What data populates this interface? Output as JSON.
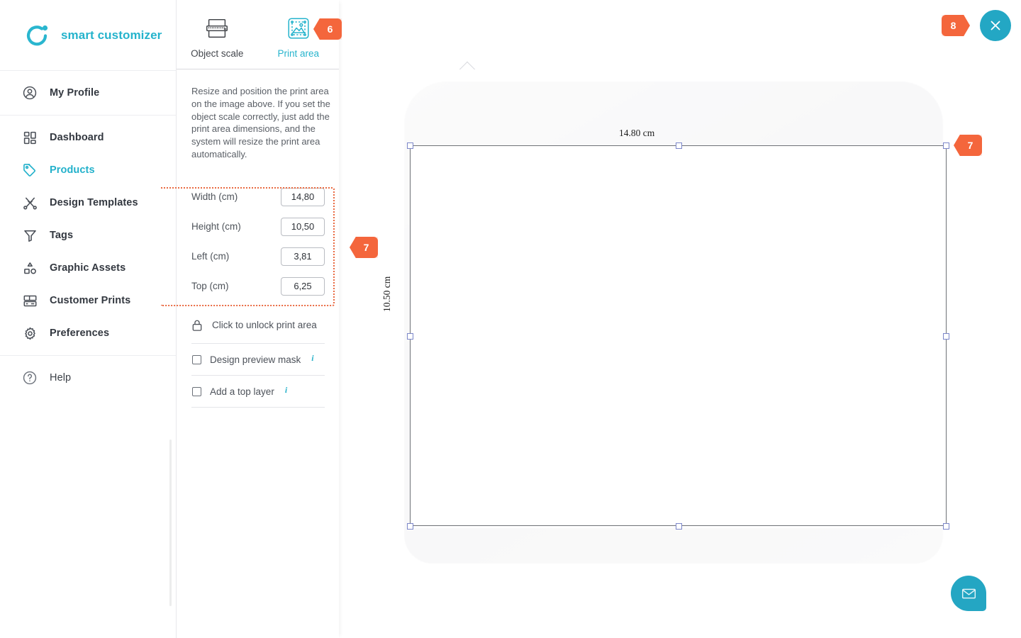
{
  "brand": {
    "name": "smart customizer",
    "logo_icon": "circle-dot-logo",
    "color": "#25b3cc"
  },
  "sidebar": {
    "profile": {
      "label": "My Profile",
      "icon": "user-circle-icon"
    },
    "items": [
      {
        "label": "Dashboard",
        "icon": "dashboard-grid-icon",
        "active": false
      },
      {
        "label": "Products",
        "icon": "tag-icon",
        "active": true
      },
      {
        "label": "Design Templates",
        "icon": "scissors-icon",
        "active": false
      },
      {
        "label": "Tags",
        "icon": "funnel-icon",
        "active": false
      },
      {
        "label": "Graphic Assets",
        "icon": "shapes-icon",
        "active": false
      },
      {
        "label": "Customer Prints",
        "icon": "layout-rows-icon",
        "active": false
      },
      {
        "label": "Preferences",
        "icon": "gear-icon",
        "active": false
      }
    ],
    "help": {
      "label": "Help",
      "icon": "question-circle-icon"
    }
  },
  "panel": {
    "tabs": [
      {
        "label": "Object scale",
        "icon": "ruler-icon",
        "active": false
      },
      {
        "label": "Print area",
        "icon": "print-area-icon",
        "active": true
      }
    ],
    "description": "Resize and position the print area on the image above. If you set the object scale correctly, just add the print area dimensions, and the system will resize the print area automatically.",
    "fields": [
      {
        "label": "Width (cm)",
        "value": "14,80"
      },
      {
        "label": "Height (cm)",
        "value": "10,50"
      },
      {
        "label": "Left (cm)",
        "value": "3,81"
      },
      {
        "label": "Top (cm)",
        "value": "6,25"
      }
    ],
    "lock_row": {
      "label": "Click to unlock print area",
      "icon": "lock-icon"
    },
    "checkboxes": [
      {
        "label": "Design preview mask",
        "checked": false,
        "info": "i"
      },
      {
        "label": "Add a top layer",
        "checked": false,
        "info": "i"
      }
    ]
  },
  "canvas": {
    "dim_top": "14.80 cm",
    "dim_left": "10.50 cm"
  },
  "badges": {
    "six": "6",
    "seven_panel": "7",
    "seven_canvas": "7",
    "eight": "8",
    "color": "#f4663c"
  },
  "actions": {
    "close": {
      "icon": "close-icon",
      "color": "#23a7c4"
    },
    "chat": {
      "icon": "envelope-icon",
      "color": "#24a6c3"
    }
  }
}
